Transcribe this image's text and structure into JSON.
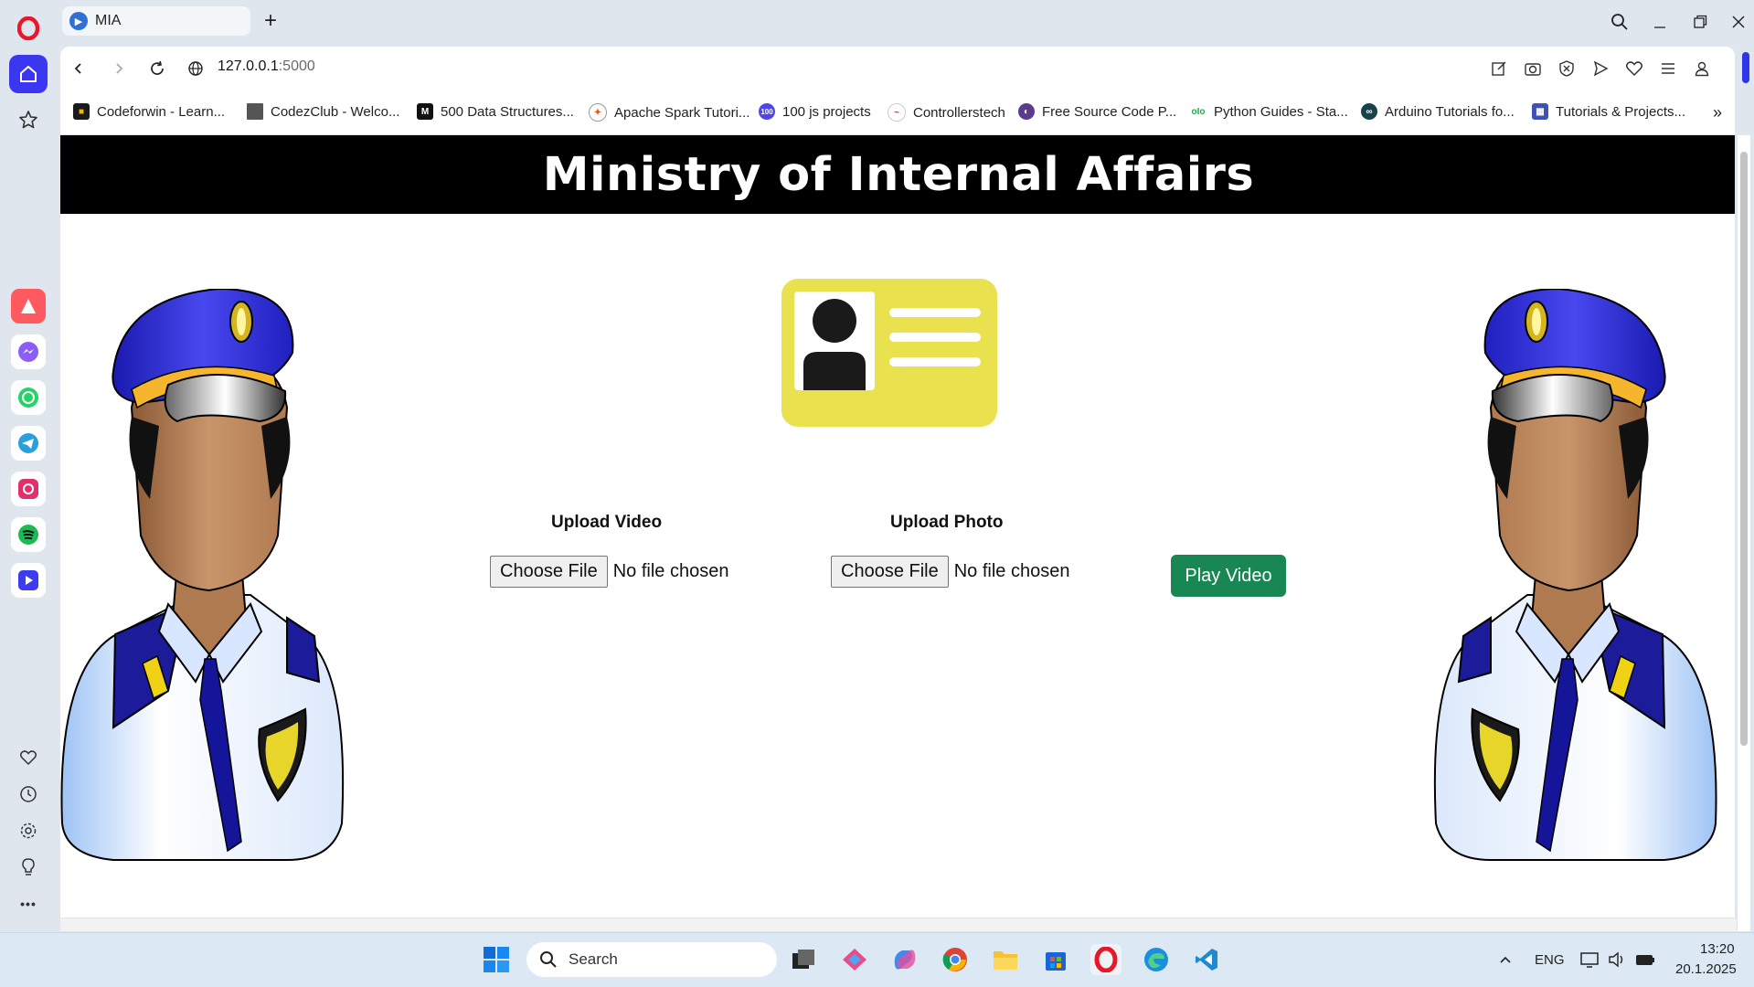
{
  "browser": {
    "tab_title": "MIA",
    "url_host": "127.0.0.1",
    "url_port": ":5000",
    "new_tab_label": "+",
    "bookmarks": [
      "Codeforwin - Learn...",
      "CodezClub - Welco...",
      "500 Data Structures...",
      "Apache Spark Tutori...",
      "100 js projects",
      "Controllerstech",
      "Free Source Code P...",
      "Python Guides - Sta...",
      "Arduino Tutorials fo...",
      "Tutorials & Projects..."
    ],
    "bookmarks_more": "»",
    "accent_color": "#2e36e8"
  },
  "sidebar": {
    "apps": [
      "aria-icon",
      "messenger-icon",
      "whatsapp-icon",
      "telegram-icon",
      "instagram-icon",
      "spotify-icon",
      "player-icon"
    ],
    "bottom": [
      "heart-icon",
      "history-icon",
      "settings-icon",
      "lightbulb-icon"
    ],
    "more_label": "•••"
  },
  "page": {
    "title": "Ministry of Internal Affairs",
    "upload_video_label": "Upload Video",
    "upload_photo_label": "Upload Photo",
    "choose_file_label": "Choose File",
    "no_file_text": "No file chosen",
    "play_button": "Play Video",
    "play_button_color": "#198754"
  },
  "taskbar": {
    "search_placeholder": "Search",
    "language": "ENG",
    "time": "13:20",
    "date": "20.1.2025"
  }
}
